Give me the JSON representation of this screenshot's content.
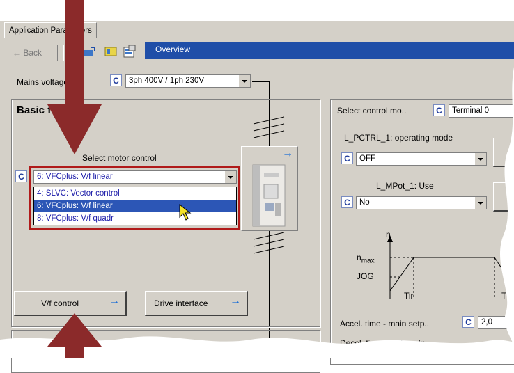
{
  "tabs": {
    "application_parameters": "Application Parameters"
  },
  "toolbar": {
    "back_label": "Back",
    "overview_label": "Overview"
  },
  "mains": {
    "label": "Mains voltage",
    "value": "3ph 400V / 1ph 230V",
    "c": "C"
  },
  "basic": {
    "title": "Basic functions",
    "motor_label": "Select motor control",
    "motor_value": "6:  VFCplus: V/f linear"
  },
  "motor_options": [
    {
      "label": "4:   SLVC: Vector control"
    },
    {
      "label": "6:   VFCplus: V/f linear"
    },
    {
      "label": "8:   VFCplus: V/f quadr"
    }
  ],
  "buttons": {
    "vf_control": "V/f control",
    "drive_interface": "Drive interface"
  },
  "right": {
    "control_mode_label": "Select control mo..",
    "control_mode_value": "Terminal 0",
    "pctrl_label": "L_PCTRL_1: operating mode",
    "pctrl_value": "OFF",
    "mpot_label": "L_MPot_1: Use",
    "mpot_value": "No",
    "graph_n": "n",
    "graph_nmax": "n",
    "graph_nmax_sub": "max",
    "graph_jog": "JOG",
    "graph_tir": "Tir",
    "graph_t": "T",
    "accel_label": "Accel. time - main setp..",
    "accel_value": "2,0",
    "decel_label": "Decel. time - main setp.."
  },
  "c_label": "C",
  "colors": {
    "panel": "#d4d0c8",
    "title_bar": "#1f4ea8",
    "highlight_frame": "#b01a1a",
    "annotation_arrow": "#8b2a2a"
  }
}
